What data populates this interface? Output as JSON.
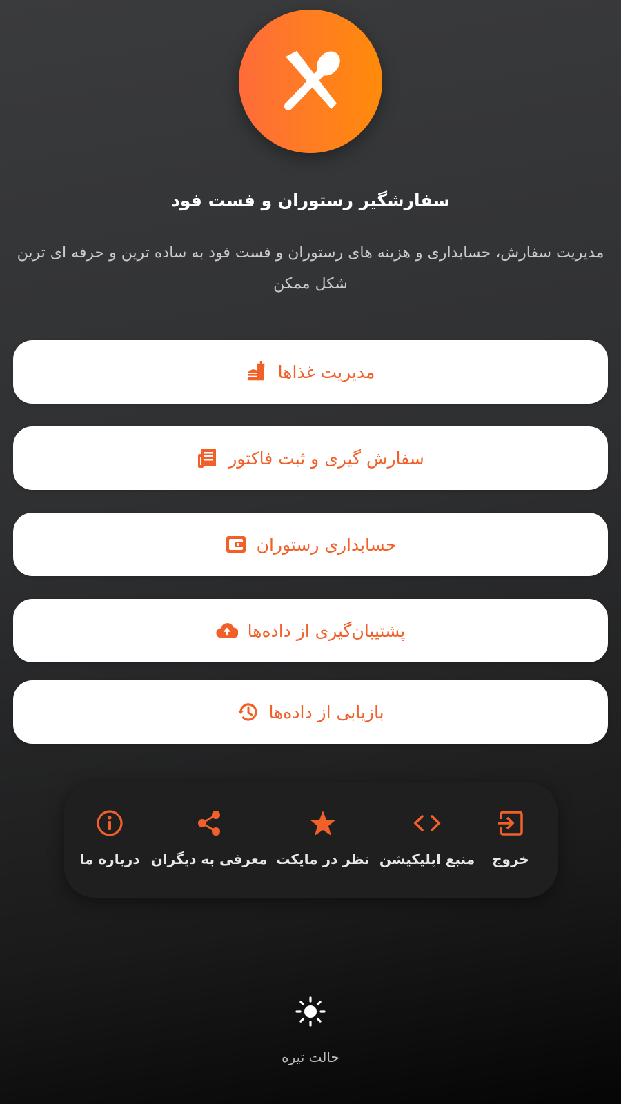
{
  "app": {
    "title": "سفارشگیر رستوران و فست فود",
    "description": "مدیریت سفارش، حسابداری و هزینه های رستوران و فست فود به ساده ترین و حرفه ای ترین شکل ممکن",
    "accent_color": "#f2602a",
    "logo_icon": "fork-spoon-icon"
  },
  "menu": [
    {
      "label": "مدیریت غذاها",
      "icon": "fast-food-icon"
    },
    {
      "label": "سفارش گیری و ثبت فاکتور",
      "icon": "receipt-icon"
    },
    {
      "label": "حسابداری رستوران",
      "icon": "wallet-icon"
    },
    {
      "label": "پشتیبان‌گیری از داده‌ها",
      "icon": "cloud-upload-icon"
    },
    {
      "label": "بازیابی از داده‌ها",
      "icon": "restore-history-icon"
    }
  ],
  "bottom_bar": [
    {
      "label": "خروج",
      "icon": "exit-icon"
    },
    {
      "label": "منبع اپلیکیشن",
      "icon": "code-icon"
    },
    {
      "label": "نظر در مایکت",
      "icon": "star-icon"
    },
    {
      "label": "معرفی به دیگران",
      "icon": "share-icon"
    },
    {
      "label": "درباره ما",
      "icon": "info-icon"
    }
  ],
  "theme_toggle": {
    "label": "حالت تیره",
    "icon": "sun-icon"
  }
}
